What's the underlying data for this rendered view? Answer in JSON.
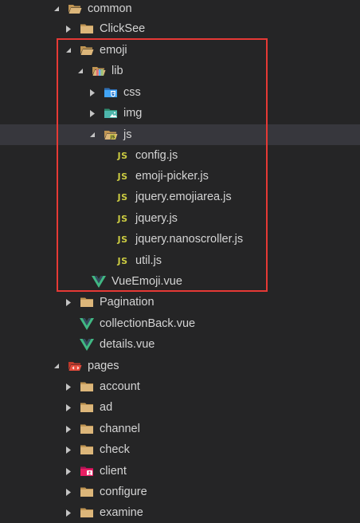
{
  "explorer": {
    "items": [
      {
        "label": "common",
        "icon": "folder-open-icon",
        "expanded": true
      },
      {
        "label": "ClickSee",
        "icon": "folder-icon",
        "expanded": false
      },
      {
        "label": "emoji",
        "icon": "folder-open-icon",
        "expanded": true
      },
      {
        "label": "lib",
        "icon": "lib-folder-icon",
        "expanded": true
      },
      {
        "label": "css",
        "icon": "css-folder-icon",
        "expanded": false
      },
      {
        "label": "img",
        "icon": "image-folder-icon",
        "expanded": false
      },
      {
        "label": "js",
        "icon": "js-folder-open-icon",
        "expanded": true
      },
      {
        "label": "config.js",
        "icon": "js-file-icon",
        "badge": "JS"
      },
      {
        "label": "emoji-picker.js",
        "icon": "js-file-icon",
        "badge": "JS"
      },
      {
        "label": "jquery.emojiarea.js",
        "icon": "js-file-icon",
        "badge": "JS"
      },
      {
        "label": "jquery.js",
        "icon": "js-file-icon",
        "badge": "JS"
      },
      {
        "label": "jquery.nanoscroller.js",
        "icon": "js-file-icon",
        "badge": "JS"
      },
      {
        "label": "util.js",
        "icon": "js-file-icon",
        "badge": "JS"
      },
      {
        "label": "VueEmoji.vue",
        "icon": "vue-file-icon"
      },
      {
        "label": "Pagination",
        "icon": "folder-icon",
        "expanded": false
      },
      {
        "label": "collectionBack.vue",
        "icon": "vue-file-icon"
      },
      {
        "label": "details.vue",
        "icon": "vue-file-icon"
      },
      {
        "label": "pages",
        "icon": "pages-folder-open-icon",
        "expanded": true
      },
      {
        "label": "account",
        "icon": "folder-icon",
        "expanded": false
      },
      {
        "label": "ad",
        "icon": "folder-icon",
        "expanded": false
      },
      {
        "label": "channel",
        "icon": "folder-icon",
        "expanded": false
      },
      {
        "label": "check",
        "icon": "folder-icon",
        "expanded": false
      },
      {
        "label": "client",
        "icon": "client-folder-icon",
        "expanded": false
      },
      {
        "label": "configure",
        "icon": "folder-icon",
        "expanded": false
      },
      {
        "label": "examine",
        "icon": "folder-icon",
        "expanded": false
      }
    ],
    "selected_label": "js"
  },
  "colors": {
    "background": "#252526",
    "selected_row": "#37373d",
    "folder": "#c09553",
    "vue": "#41b883",
    "js_badge": "#cbcb41",
    "highlight_border": "#e63935"
  }
}
